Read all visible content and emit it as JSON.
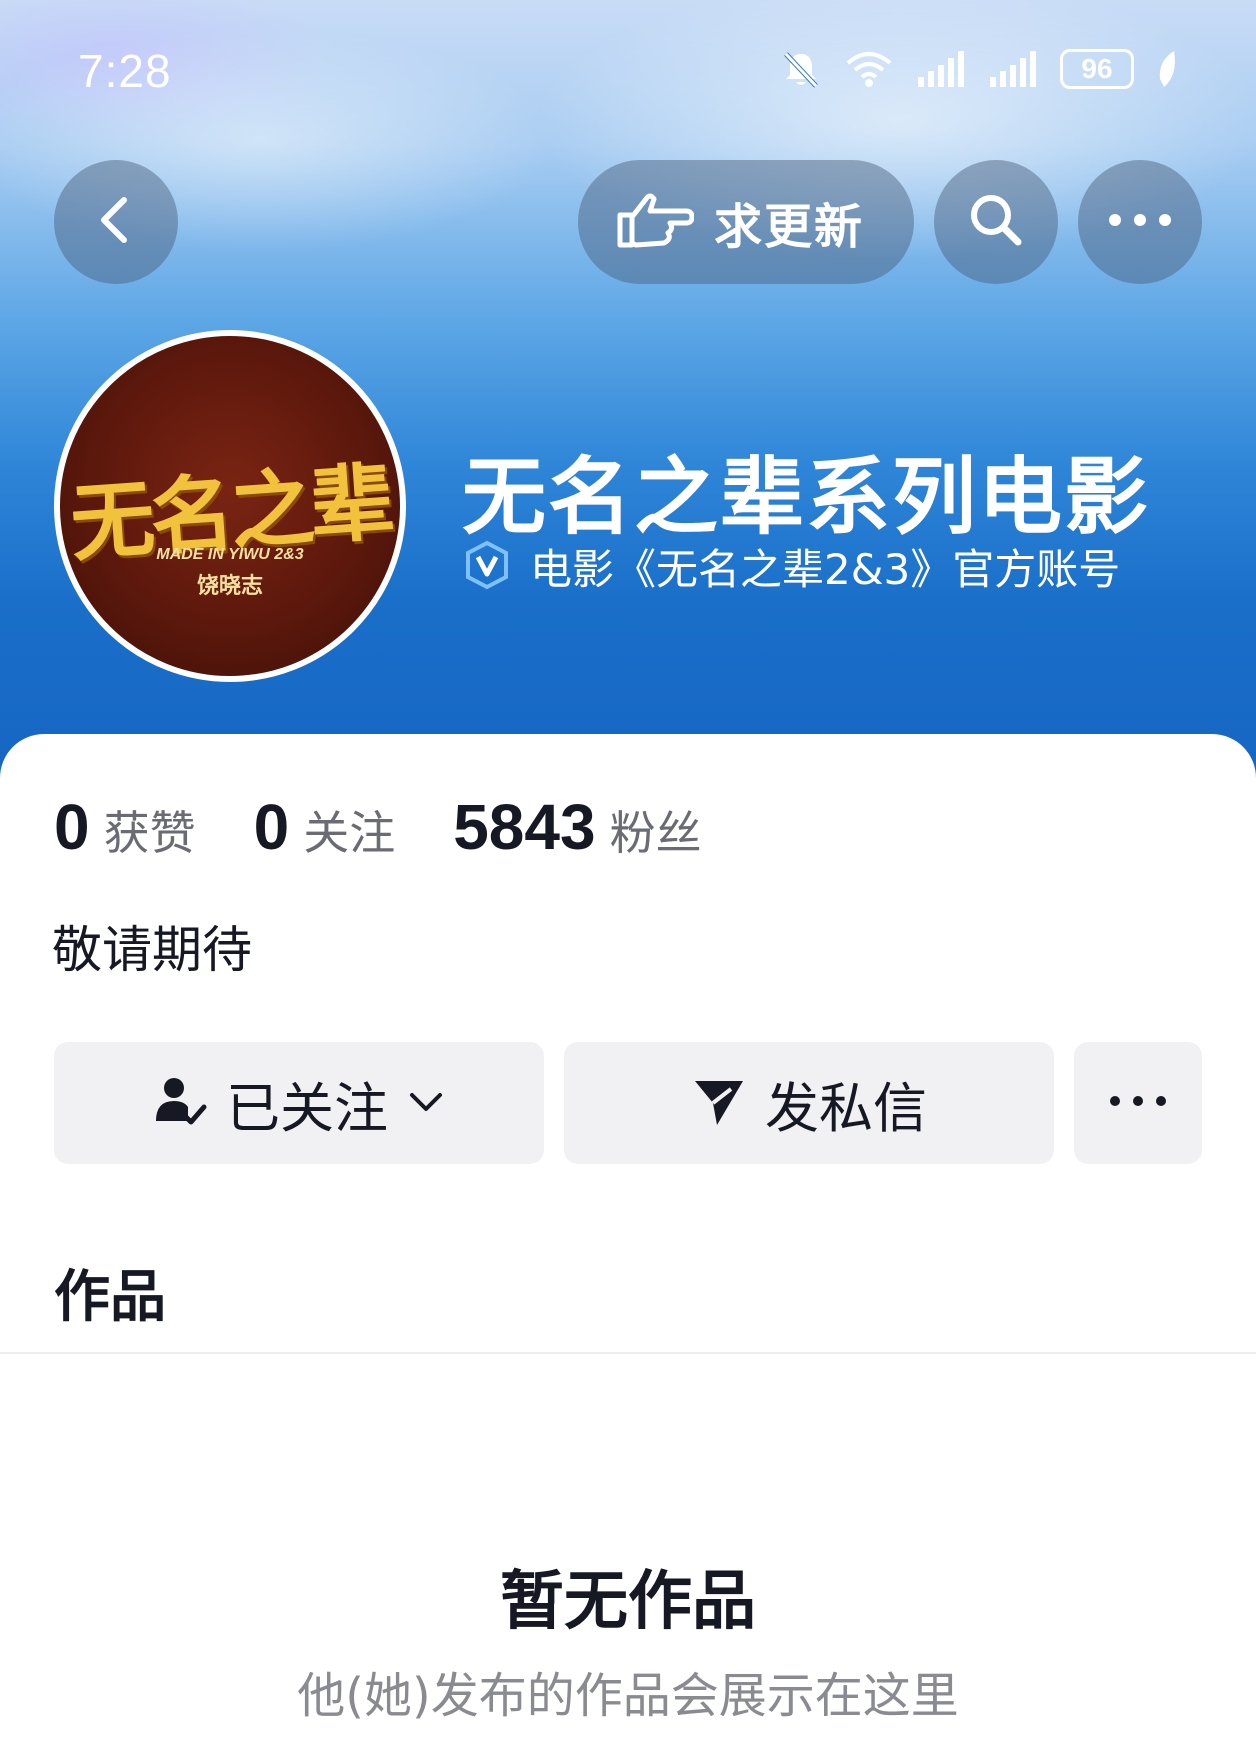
{
  "status_bar": {
    "time": "7:28",
    "battery": "96",
    "icons": [
      "bell-muted-icon",
      "wifi-icon",
      "signal-icon",
      "signal-icon",
      "battery-icon",
      "leaf-icon"
    ]
  },
  "top_nav": {
    "back_icon": "chevron-left-icon",
    "request_update_label": "求更新",
    "request_update_icon": "hand-pointing-icon",
    "search_icon": "search-icon",
    "more_icon": "more-horizontal-icon"
  },
  "profile": {
    "name": "无名之辈系列电影",
    "verification": "电影《无名之辈2&3》官方账号",
    "verification_icon": "verified-v-icon",
    "avatar": {
      "logo_text": "无名之辈",
      "subtitle": "MADE IN YIWU 2&3",
      "director": "饶晓志"
    },
    "bio": "敬请期待"
  },
  "stats": [
    {
      "value": "0",
      "label": "获赞"
    },
    {
      "value": "0",
      "label": "关注"
    },
    {
      "value": "5843",
      "label": "粉丝"
    }
  ],
  "actions": {
    "follow_label": "已关注",
    "message_label": "发私信"
  },
  "works": {
    "tab_label": "作品",
    "empty_title": "暂无作品",
    "empty_desc": "他(她)发布的作品会展示在这里"
  },
  "colors": {
    "header_blue": "#1a6fc9",
    "text_primary": "#161823",
    "text_secondary": "#6a6b73",
    "button_bg": "#f1f1f3"
  }
}
